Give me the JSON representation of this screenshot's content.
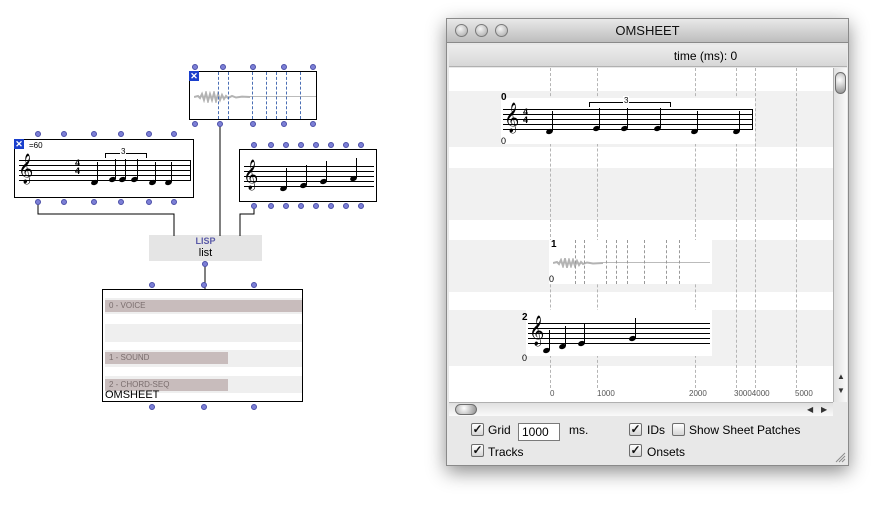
{
  "patch": {
    "voice_tempo": "=60",
    "tuplet": "3",
    "lisp_label": "LISP",
    "lisp_function": "list",
    "omsheet_label": "OMSHEET",
    "tracks": [
      {
        "label": "0 - VOICE"
      },
      {
        "label": "1 - SOUND"
      },
      {
        "label": "2 - CHORD-SEQ"
      }
    ]
  },
  "window": {
    "title": "OMSHEET",
    "time_label": "time (ms): 0",
    "track_numbers": [
      "0",
      "1",
      "2"
    ],
    "zero_marks": [
      "0",
      "0",
      "0"
    ],
    "tuplet": "3",
    "axis_ticks": [
      "0",
      "1000",
      "2000",
      "30004000",
      "5000"
    ],
    "controls": {
      "grid_label": "Grid",
      "grid_checked": true,
      "grid_value": "1000",
      "grid_unit": "ms.",
      "tracks_label": "Tracks",
      "tracks_checked": true,
      "ids_label": "IDs",
      "ids_checked": true,
      "show_patches_label": "Show Sheet Patches",
      "show_patches_checked": false,
      "onsets_label": "Onsets",
      "onsets_checked": true
    }
  },
  "colors": {
    "inlet": "#7c7fd6",
    "selected_x": "#1a3fcc",
    "track_band": "#c8bcbc",
    "marker_lines": "#4a6fb5"
  }
}
